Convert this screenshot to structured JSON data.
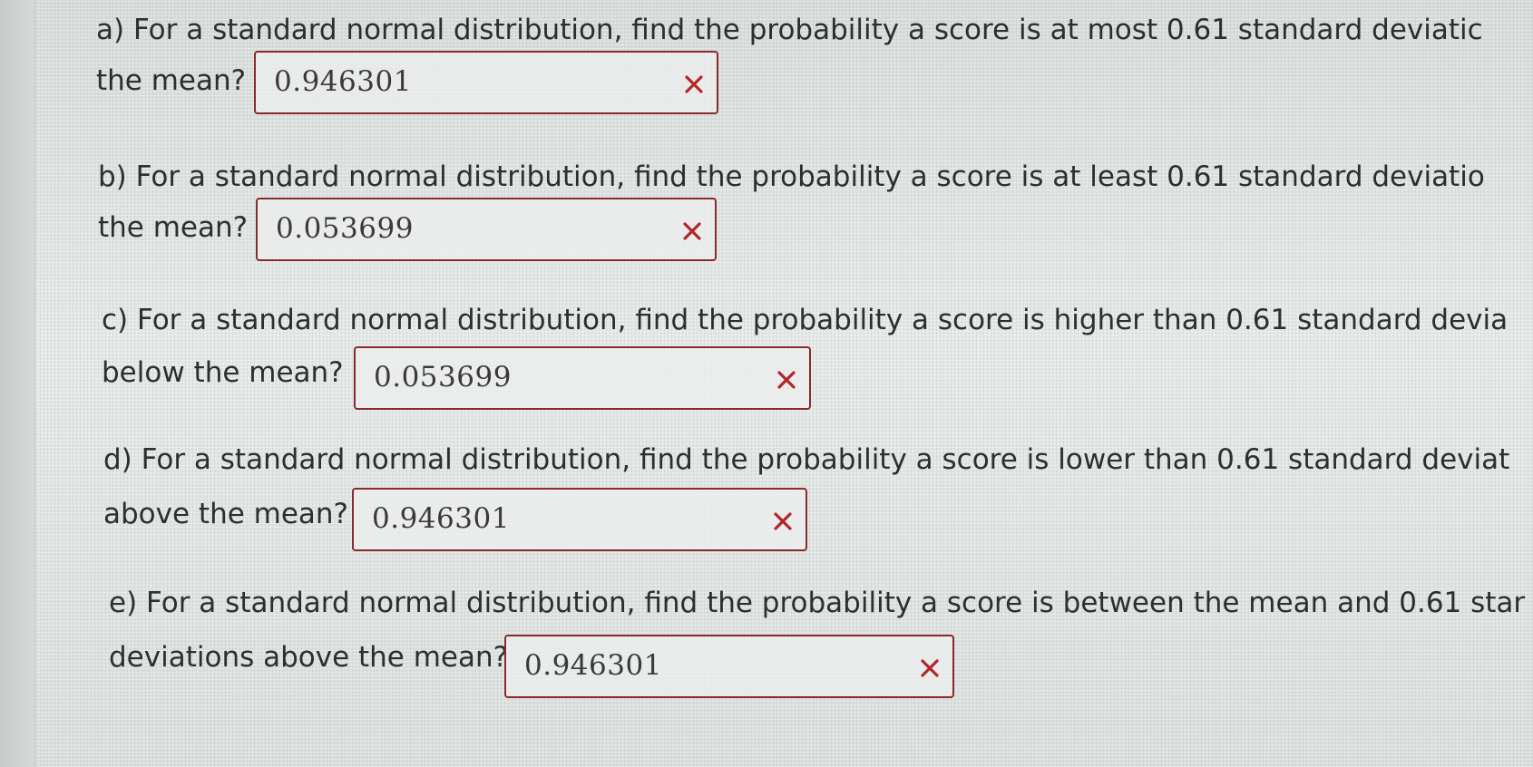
{
  "questions": [
    {
      "line1": "a) For a standard normal distribution, find the probability a score is at most 0.61 standard deviatic",
      "line2": "the mean?",
      "answer": "0.946301",
      "status_icon": "incorrect-x-icon"
    },
    {
      "line1": "b) For a standard normal distribution, find the probability a score is at least 0.61 standard deviatio",
      "line2": "the mean?",
      "answer": "0.053699",
      "status_icon": "incorrect-x-icon"
    },
    {
      "line1": "c) For a standard normal distribution, find the probability a score is higher than 0.61 standard devia",
      "line2": "below the mean?",
      "answer": "0.053699",
      "status_icon": "incorrect-x-icon"
    },
    {
      "line1": "d) For a standard normal distribution, find the probability a score is lower than 0.61 standard deviat",
      "line2": "above the mean?",
      "answer": "0.946301",
      "status_icon": "incorrect-x-icon"
    },
    {
      "line1": "e) For a standard normal distribution, find the probability a score is between the mean and 0.61 star",
      "line2": "deviations above the mean?",
      "answer": "0.946301",
      "status_icon": "incorrect-x-icon"
    }
  ],
  "colors": {
    "incorrect_mark": "#b3262b",
    "box_border": "#8a2a2a",
    "text": "#2e2e2e"
  }
}
